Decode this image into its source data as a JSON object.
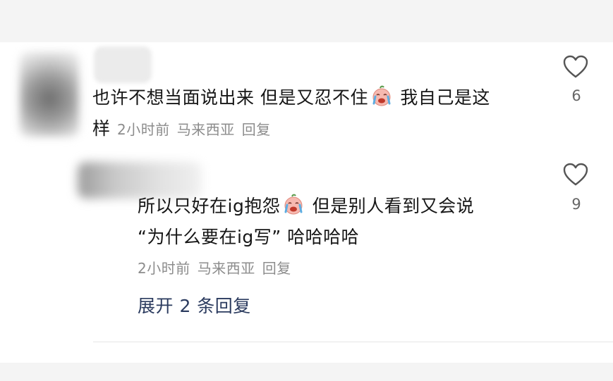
{
  "comments": [
    {
      "text_part1": "也许不想当面说出来 但是又忍不住",
      "text_part2": " 我自己是这",
      "text_line2": "样",
      "time": "2小时前",
      "location": "马来西亚",
      "reply_label": "回复",
      "emoji": "crying-face-emoji",
      "likes": "6"
    },
    {
      "text_part1": "所以只好在ig抱怨",
      "text_part2": " 但是别人看到又会说",
      "text_line2": "“为什么要在ig写” 哈哈哈哈",
      "time": "2小时前",
      "location": "马来西亚",
      "reply_label": "回复",
      "emoji": "crying-face-emoji",
      "likes": "9"
    }
  ],
  "expand_replies_label": "展开 2 条回复",
  "colors": {
    "text": "#161616",
    "meta": "#8c8c8c",
    "link": "#2a3a5e",
    "heart_stroke": "#555555"
  }
}
